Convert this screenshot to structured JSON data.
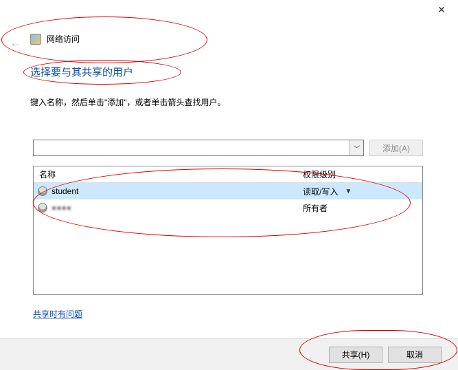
{
  "window": {
    "close_tooltip": "关闭"
  },
  "header": {
    "icon": "network-access-icon",
    "title": "网络访问"
  },
  "heading": "选择要与其共享的用户",
  "subheading": "键入名称，然后单击\"添加\"，或者单击箭头查找用户。",
  "search": {
    "value": "",
    "add_label": "添加(A)"
  },
  "table": {
    "columns": {
      "name": "名称",
      "permission": "权限级别"
    },
    "rows": [
      {
        "icon": "user-icon",
        "name": "student",
        "permission": "读取/写入",
        "has_dropdown": true,
        "selected": true
      },
      {
        "icon": "user-icon",
        "name": "●●●●",
        "permission": "所有者",
        "has_dropdown": false,
        "selected": false,
        "obscured": true
      }
    ]
  },
  "help_link": "共享时有问题",
  "footer": {
    "share_label": "共享(H)",
    "cancel_label": "取消"
  }
}
